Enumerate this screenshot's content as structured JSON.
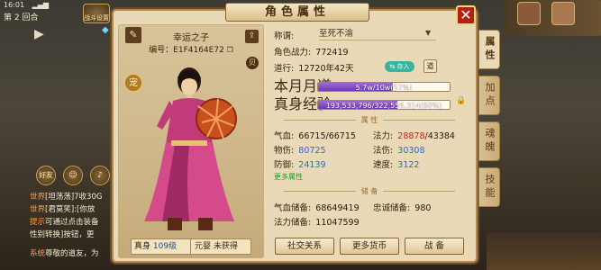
{
  "status": {
    "time": "16:01",
    "signal": "▂▄▆"
  },
  "round": {
    "round_label": "第 2 回合",
    "battle_label": "战斗设置"
  },
  "chat": [
    {
      "tag": "世界",
      "text": "[坦荡荡]7收30G"
    },
    {
      "tag": "世界",
      "text": "[君莫笑]:[你放"
    },
    {
      "tag": "提示",
      "text": "可通过点击装备"
    },
    {
      "tag": "",
      "text": "性别转换]按钮，更"
    },
    {
      "tag": "系统",
      "text": "尊敬的道友，为"
    }
  ],
  "left_icons": {
    "friend_label": "好友"
  },
  "panel": {
    "title": "角色属性",
    "close_label": "✕",
    "character": {
      "name": "幸运之子",
      "id_label": "编号：",
      "id_value": "E1F4164E72",
      "level_label": "真身",
      "level_value": "109级",
      "yuanying_label": "元婴",
      "yuanying_value": "未获得",
      "bei_label": "贝",
      "pet_label": "宠"
    },
    "info": {
      "title_label": "称谓:",
      "title_value": "至死不渝",
      "power_label": "角色战力:",
      "power_value": "772419",
      "dao_label": "道行:",
      "dao_value": "12720年42天",
      "dao_badge": "⇆ 存入",
      "dao_button": "道",
      "month_label": "本月月道",
      "month_text": "5.7w/10w(57%)",
      "month_pct": 57,
      "exp_label": "真身经验",
      "exp_text": "193,533,796/322,556,314(60%)",
      "exp_pct": 60
    },
    "attr_section": "属 性",
    "attrs": {
      "hp_label": "气血:",
      "hp_value": "66715/66715",
      "mp_label": "法力:",
      "mp_cur": "28878",
      "mp_max": "/43384",
      "patk_label": "物伤:",
      "patk_value": "80725",
      "matk_label": "法伤:",
      "matk_value": "30308",
      "def_label": "防御:",
      "def_value": "24139",
      "spd_label": "速度:",
      "spd_value": "3122",
      "more_label": "更多属性"
    },
    "store_section": "储 备",
    "store": {
      "hp_label": "气血储备:",
      "hp_value": "68649419",
      "loyal_label": "忠诚储备:",
      "loyal_value": "980",
      "mp_label": "法力储备:",
      "mp_value": "11047599"
    },
    "buttons": {
      "social": "社交关系",
      "currency": "更多货币",
      "battle": "战 备"
    }
  },
  "tabs": [
    "属性",
    "加点",
    "魂魄",
    "技能"
  ],
  "colors": {
    "accent_red": "#d02020",
    "accent_blue": "#2a6ad0",
    "bar_purple": "#7b45bf",
    "panel_bg": "#ead9b6"
  }
}
